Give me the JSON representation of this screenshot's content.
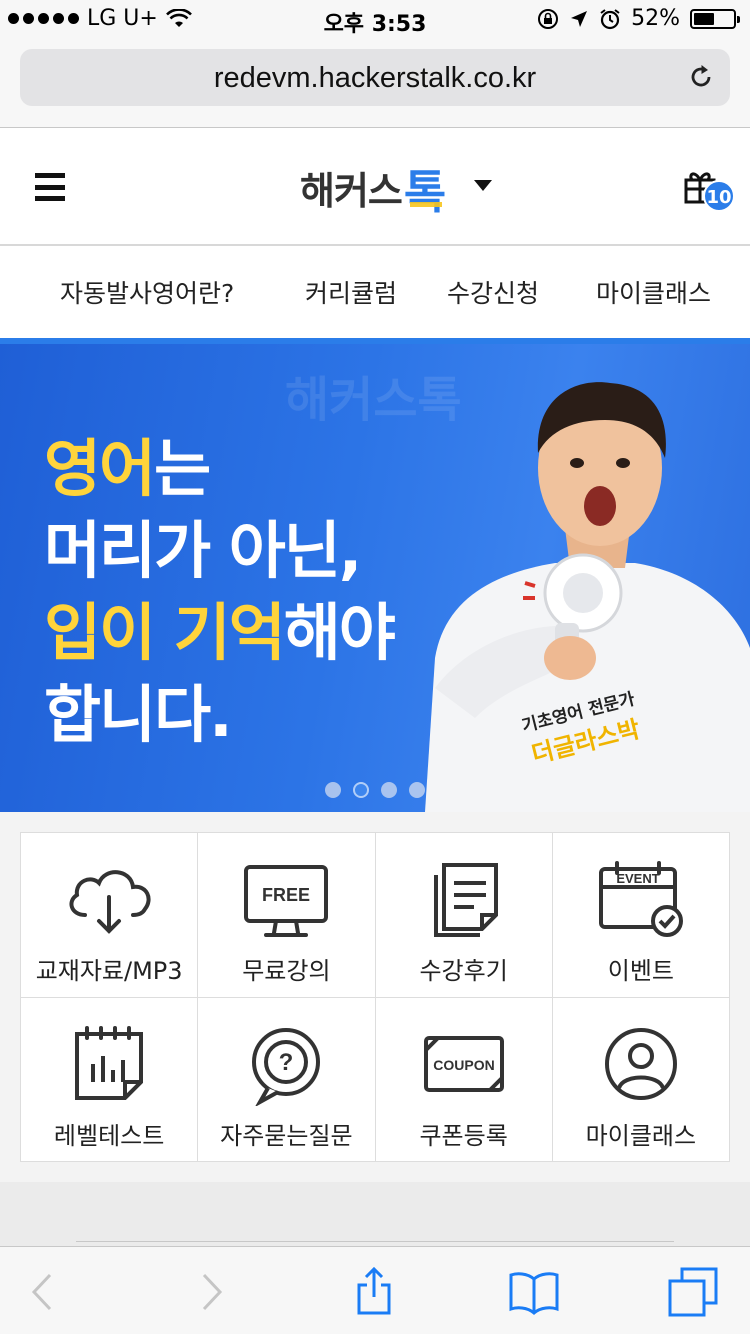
{
  "status_bar": {
    "carrier": "LG U+",
    "time": "오후 3:53",
    "battery_percent": 52,
    "battery_label": "52%"
  },
  "url_bar": {
    "url": "redevm.hackerstalk.co.kr"
  },
  "header": {
    "logo_text": "해커스",
    "logo_accent": "톡",
    "gift_badge": "10"
  },
  "nav": {
    "items": [
      "자동발사영어란?",
      "커리큘럼",
      "수강신청",
      "마이클래스"
    ]
  },
  "banner": {
    "bg_logo": "해커스톡",
    "line1_highlight": "영어",
    "line1_rest": "는",
    "line2": "머리가 아닌,",
    "line3_highlight": "입이 기억",
    "line3_rest": "해야",
    "line4": "합니다.",
    "tag_small": "기초영어 전문가",
    "tag_name": "더글라스박",
    "pager_total": 4,
    "pager_active": 2
  },
  "menu": {
    "items": [
      {
        "label": "교재자료/MP3",
        "icon": "cloud-download-icon"
      },
      {
        "label": "무료강의",
        "icon": "free-monitor-icon",
        "icon_text": "FREE"
      },
      {
        "label": "수강후기",
        "icon": "documents-icon"
      },
      {
        "label": "이벤트",
        "icon": "event-calendar-icon",
        "icon_text": "EVENT"
      },
      {
        "label": "레벨테스트",
        "icon": "level-test-icon"
      },
      {
        "label": "자주묻는질문",
        "icon": "faq-bubble-icon",
        "icon_text": "?"
      },
      {
        "label": "쿠폰등록",
        "icon": "coupon-icon",
        "icon_text": "COUPON"
      },
      {
        "label": "마이클래스",
        "icon": "user-icon"
      }
    ]
  },
  "colors": {
    "accent": "#2b7de9",
    "highlight": "#ffd43b",
    "banner_bg": "#2c74e6",
    "ios_blue": "#1a7cf5"
  }
}
